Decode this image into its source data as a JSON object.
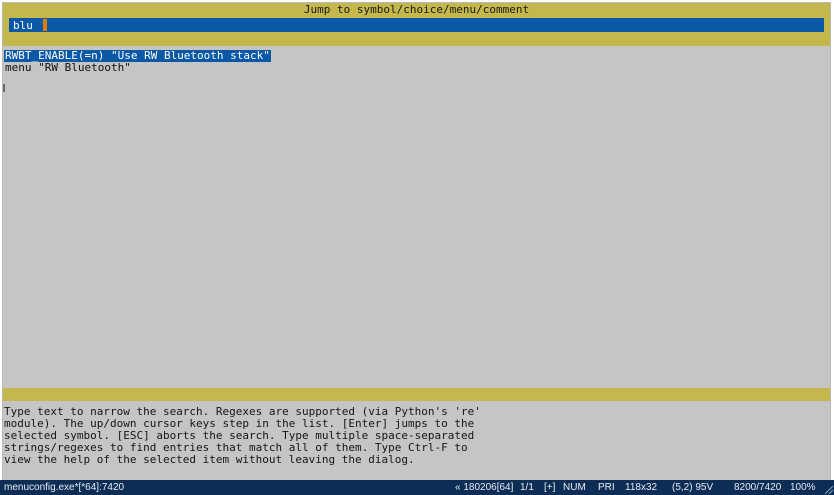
{
  "dialog": {
    "title": "Jump to symbol/choice/menu/comment",
    "search_value": "blu"
  },
  "results": [
    {
      "label": "RWBT_ENABLE(=n) \"Use RW Bluetooth stack\"",
      "selected": true
    },
    {
      "label": "menu \"RW Bluetooth\"",
      "selected": false
    }
  ],
  "help_lines": [
    "Type text to narrow the search. Regexes are supported (via Python's 're'",
    "module). The up/down cursor keys step in the list. [Enter] jumps to the",
    "selected symbol. [ESC] aborts the search. Type multiple space-separated",
    "strings/regexes to find entries that match all of them. Type Ctrl-F to",
    "view the help of the selected item without leaving the dialog."
  ],
  "statusbar": {
    "tab_label": "menuconfig.exe*[*64]:7420",
    "build": "« 180206[64]",
    "position": "1/1",
    "modifier": "[+]",
    "num": "NUM",
    "pri": "PRI",
    "size": "118x32",
    "cursor": "(5,2) 95V",
    "pid": "8200/7420",
    "zoom": "100%"
  },
  "colors": {
    "header_band": "#c4b74b",
    "selection": "#0b58a7",
    "caret": "#e07b00",
    "window_bg": "#c5c5c5",
    "statusbar": "#0d2d54"
  },
  "icons": {
    "grip": "resize-grip-icon"
  }
}
